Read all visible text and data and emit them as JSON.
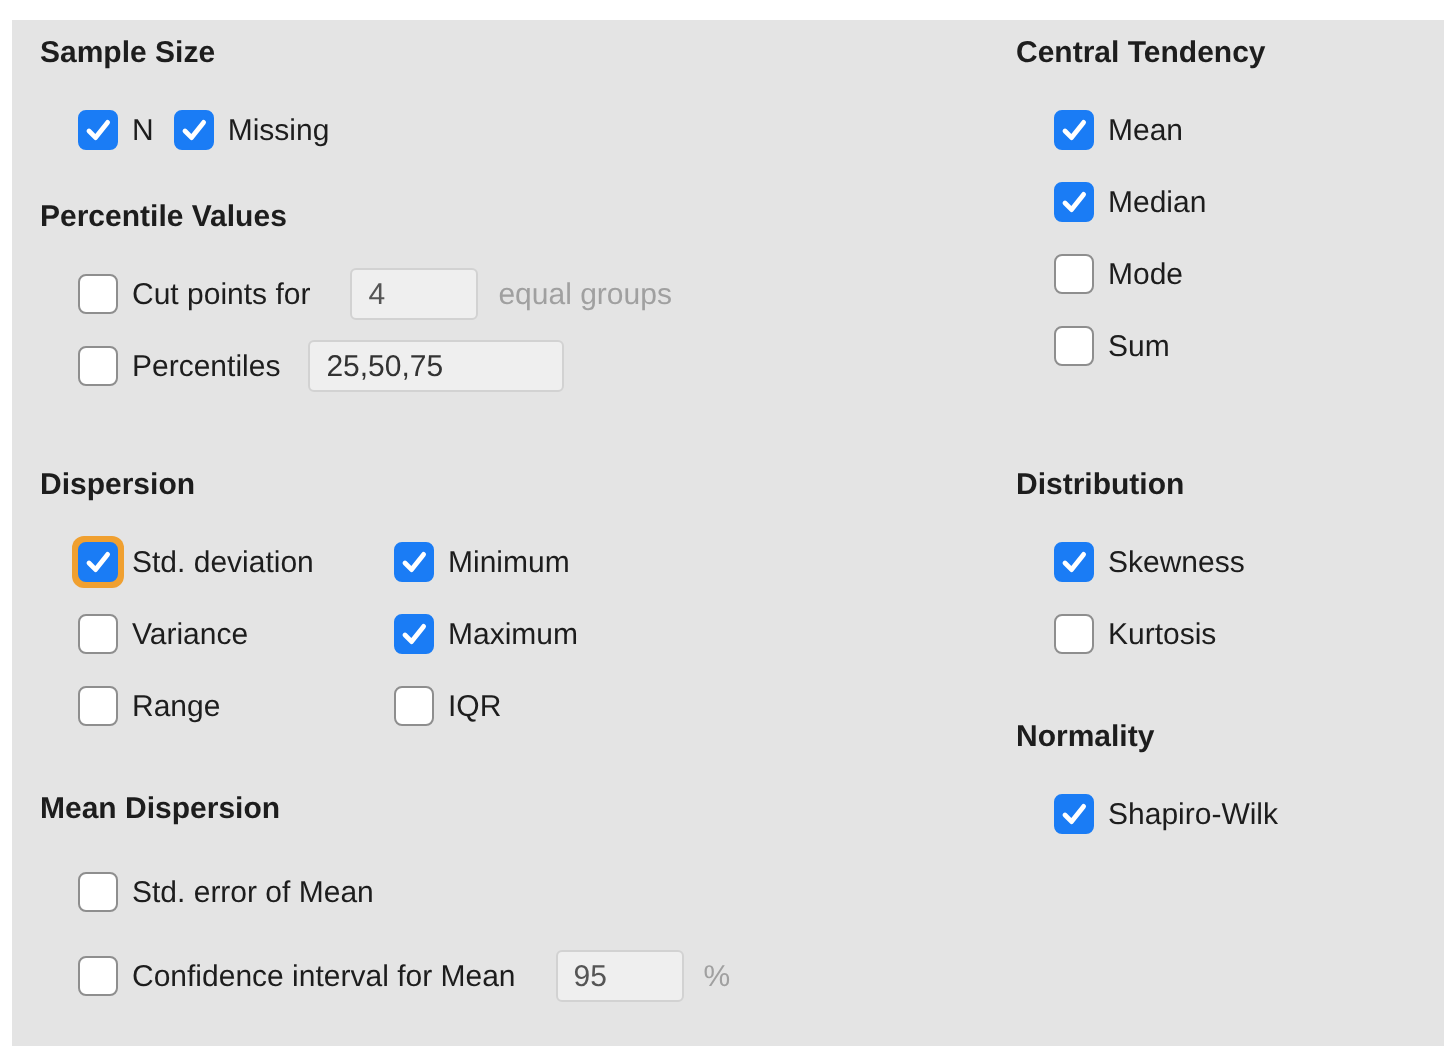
{
  "groups": [
    {
      "left": [
        {
          "title": "Sample Size",
          "rows": [
            {
              "items": [
                {
                  "kind": "checkbox",
                  "label": "N",
                  "checked": true,
                  "focused": false
                },
                {
                  "kind": "checkbox",
                  "label": "Missing",
                  "checked": true,
                  "focused": false
                }
              ]
            }
          ]
        },
        {
          "title": "Percentile Values",
          "rows": [
            {
              "items": [
                {
                  "kind": "checkbox",
                  "label": "Cut points for",
                  "checked": false,
                  "focused": false
                },
                {
                  "kind": "field",
                  "value": "4",
                  "disabled": true
                },
                {
                  "kind": "suffix",
                  "text": "equal groups",
                  "disabled": true
                }
              ]
            },
            {
              "items": [
                {
                  "kind": "checkbox",
                  "label": "Percentiles",
                  "checked": false,
                  "focused": false
                },
                {
                  "kind": "field",
                  "value": "25,50,75",
                  "disabled": false
                }
              ]
            }
          ]
        }
      ],
      "right": [
        {
          "title": "Central Tendency",
          "rows": [
            {
              "items": [
                {
                  "kind": "checkbox",
                  "label": "Mean",
                  "checked": true,
                  "focused": false
                }
              ]
            },
            {
              "items": [
                {
                  "kind": "checkbox",
                  "label": "Median",
                  "checked": true,
                  "focused": false
                }
              ]
            },
            {
              "items": [
                {
                  "kind": "checkbox",
                  "label": "Mode",
                  "checked": false,
                  "focused": false
                }
              ]
            },
            {
              "items": [
                {
                  "kind": "checkbox",
                  "label": "Sum",
                  "checked": false,
                  "focused": false
                }
              ]
            }
          ]
        }
      ]
    },
    {
      "left": [
        {
          "title": "Dispersion",
          "rows": [
            {
              "items": [
                {
                  "kind": "checkbox",
                  "label": "Std. deviation",
                  "checked": true,
                  "focused": true
                },
                {
                  "kind": "checkbox",
                  "label": "Minimum",
                  "checked": true,
                  "focused": false
                }
              ]
            },
            {
              "items": [
                {
                  "kind": "checkbox",
                  "label": "Variance",
                  "checked": false,
                  "focused": false
                },
                {
                  "kind": "checkbox",
                  "label": "Maximum",
                  "checked": true,
                  "focused": false
                }
              ]
            },
            {
              "items": [
                {
                  "kind": "checkbox",
                  "label": "Range",
                  "checked": false,
                  "focused": false
                },
                {
                  "kind": "checkbox",
                  "label": "IQR",
                  "checked": false,
                  "focused": false
                }
              ]
            }
          ]
        },
        {
          "title": "Mean Dispersion",
          "rows": [
            {
              "items": [
                {
                  "kind": "checkbox",
                  "label": "Std. error of Mean",
                  "checked": false,
                  "focused": false
                }
              ]
            },
            {
              "items": [
                {
                  "kind": "checkbox",
                  "label": "Confidence interval for Mean",
                  "checked": false,
                  "focused": false
                },
                {
                  "kind": "field",
                  "value": "95",
                  "disabled": true
                },
                {
                  "kind": "suffix",
                  "text": "%",
                  "disabled": true
                }
              ]
            }
          ]
        }
      ],
      "right": [
        {
          "title": "Distribution",
          "rows": [
            {
              "items": [
                {
                  "kind": "checkbox",
                  "label": "Skewness",
                  "checked": true,
                  "focused": false
                }
              ]
            },
            {
              "items": [
                {
                  "kind": "checkbox",
                  "label": "Kurtosis",
                  "checked": false,
                  "focused": false
                }
              ]
            }
          ]
        },
        {
          "title": "Normality",
          "rows": [
            {
              "items": [
                {
                  "kind": "checkbox",
                  "label": "Shapiro-Wilk",
                  "checked": true,
                  "focused": false
                }
              ]
            }
          ]
        }
      ]
    }
  ]
}
